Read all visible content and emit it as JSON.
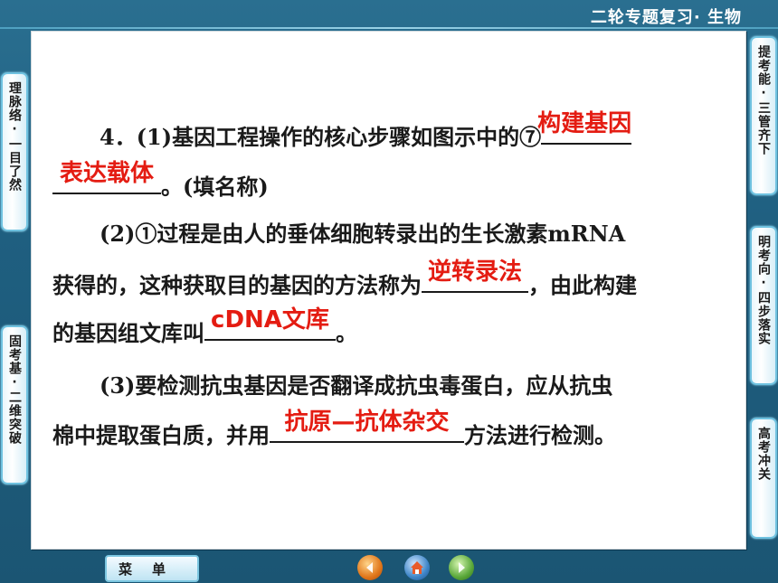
{
  "header": {
    "title": "二轮专题复习· 生物"
  },
  "left_tabs": [
    {
      "label": "理脉络·一目了然"
    },
    {
      "label": "固考基·二维突破"
    }
  ],
  "right_tabs": [
    {
      "label": "提考能·三管齐下"
    },
    {
      "label": "明考向·四步落实"
    },
    {
      "label": "高考冲关"
    }
  ],
  "question": {
    "p1_a": "4．(1)基因工程操作的核心步骤如图示中的⑦",
    "p1_ans1": "构建基因",
    "p1_ans2": "表达载体",
    "p1_b": "。(填名称)",
    "p2_a": "(2)①过程是由人的垂体细胞转录出的生长激素mRNA",
    "p2_b": "获得的，这种获取目的基因的方法称为",
    "p2_ans1": "逆转录法",
    "p2_c": "，由此构建",
    "p2_d": "的基因组文库叫",
    "p2_ans2": "cDNA文库",
    "p2_e": "。",
    "p3_a": "(3)要检测抗虫基因是否翻译成抗虫毒蛋白，应从抗虫",
    "p3_b": "棉中提取蛋白质，并用",
    "p3_ans": "抗原—抗体杂交",
    "p3_c": "方法进行检测。"
  },
  "footer": {
    "menu_label": "菜单",
    "icons": [
      "prev-icon",
      "home-icon",
      "next-icon"
    ],
    "colors": {
      "prev": "#e0761a",
      "home": "#3f86c8",
      "next": "#5aa83a"
    }
  }
}
